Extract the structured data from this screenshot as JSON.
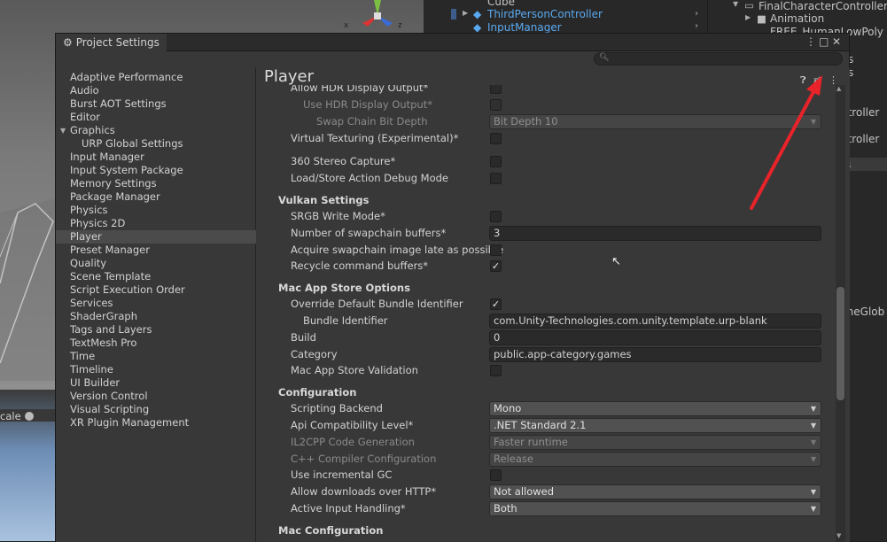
{
  "background": {
    "hierarchy": {
      "items": [
        "Cube",
        "ThirdPersonController",
        "InputManager"
      ]
    },
    "project": {
      "items": [
        "FinalCharacterController",
        "Animation",
        "FREE_HumanLowPoly"
      ],
      "clipped": [
        "s",
        "s",
        "ntroller",
        "ntroller",
        "s",
        "lineGlob",
        "r"
      ]
    },
    "scene": {
      "scale_label": "cale",
      "gizmo_x": "x",
      "gizmo_z": "z"
    }
  },
  "window": {
    "title": "Project Settings",
    "icons": {
      "menu": "⋮",
      "maximize": "□",
      "close": "✕"
    },
    "search_placeholder": ""
  },
  "sidebar": {
    "items": [
      {
        "label": "Adaptive Performance"
      },
      {
        "label": "Audio"
      },
      {
        "label": "Burst AOT Settings"
      },
      {
        "label": "Editor"
      },
      {
        "label": "Graphics",
        "expanded": true
      },
      {
        "label": "URP Global Settings",
        "child": true
      },
      {
        "label": "Input Manager"
      },
      {
        "label": "Input System Package"
      },
      {
        "label": "Memory Settings"
      },
      {
        "label": "Package Manager"
      },
      {
        "label": "Physics"
      },
      {
        "label": "Physics 2D"
      },
      {
        "label": "Player",
        "selected": true
      },
      {
        "label": "Preset Manager"
      },
      {
        "label": "Quality"
      },
      {
        "label": "Scene Template"
      },
      {
        "label": "Script Execution Order"
      },
      {
        "label": "Services"
      },
      {
        "label": "ShaderGraph"
      },
      {
        "label": "Tags and Layers"
      },
      {
        "label": "TextMesh Pro"
      },
      {
        "label": "Time"
      },
      {
        "label": "Timeline"
      },
      {
        "label": "UI Builder"
      },
      {
        "label": "Version Control"
      },
      {
        "label": "Visual Scripting"
      },
      {
        "label": "XR Plugin Management"
      }
    ]
  },
  "content": {
    "title": "Player",
    "rows": [
      {
        "label": "Allow HDR Display Output*",
        "indent": 1,
        "control": "checkbox",
        "checked": false
      },
      {
        "label": "Use HDR Display Output*",
        "indent": 2,
        "dim": true,
        "control": "checkbox",
        "checked": false
      },
      {
        "label": "Swap Chain Bit Depth",
        "indent": 3,
        "dim": true,
        "control": "dropdown",
        "value": "Bit Depth 10"
      },
      {
        "label": "Virtual Texturing (Experimental)*",
        "indent": 1,
        "control": "checkbox",
        "checked": false
      },
      {
        "label": "360 Stereo Capture*",
        "indent": 1,
        "control": "checkbox",
        "checked": false
      },
      {
        "label": "Load/Store Action Debug Mode",
        "indent": 1,
        "control": "checkbox",
        "checked": false
      },
      {
        "label": "Vulkan Settings",
        "header": true
      },
      {
        "label": "SRGB Write Mode*",
        "indent": 1,
        "control": "checkbox",
        "checked": false
      },
      {
        "label": "Number of swapchain buffers*",
        "indent": 1,
        "control": "field",
        "value": "3"
      },
      {
        "label": "Acquire swapchain image late as possible",
        "indent": 1,
        "control": "checkbox",
        "checked": false
      },
      {
        "label": "Recycle command buffers*",
        "indent": 1,
        "control": "checkbox",
        "checked": true
      },
      {
        "label": "Mac App Store Options",
        "header": true
      },
      {
        "label": "Override Default Bundle Identifier",
        "indent": 1,
        "control": "checkbox",
        "checked": true
      },
      {
        "label": "Bundle Identifier",
        "indent": 2,
        "control": "field",
        "value": "com.Unity-Technologies.com.unity.template.urp-blank"
      },
      {
        "label": "Build",
        "indent": 1,
        "control": "field",
        "value": "0"
      },
      {
        "label": "Category",
        "indent": 1,
        "control": "field",
        "value": "public.app-category.games"
      },
      {
        "label": "Mac App Store Validation",
        "indent": 1,
        "control": "checkbox",
        "checked": false
      },
      {
        "label": "Configuration",
        "header": true
      },
      {
        "label": "Scripting Backend",
        "indent": 1,
        "control": "dropdown",
        "value": "Mono"
      },
      {
        "label": "Api Compatibility Level*",
        "indent": 1,
        "control": "dropdown",
        "value": ".NET Standard 2.1"
      },
      {
        "label": "IL2CPP Code Generation",
        "indent": 1,
        "dim": true,
        "control": "dropdown",
        "value": "Faster runtime"
      },
      {
        "label": "C++ Compiler Configuration",
        "indent": 1,
        "dim": true,
        "control": "dropdown",
        "value": "Release"
      },
      {
        "label": "Use incremental GC",
        "indent": 1,
        "control": "checkbox",
        "checked": false
      },
      {
        "label": "Allow downloads over HTTP*",
        "indent": 1,
        "control": "dropdown",
        "value": "Not allowed"
      },
      {
        "label": "Active Input Handling*",
        "indent": 1,
        "control": "dropdown",
        "value": "Both"
      },
      {
        "label": "Mac Configuration",
        "header": true
      }
    ],
    "header_icons": {
      "help": "?",
      "presets": "⇄",
      "more": "⋮"
    }
  },
  "colors": {
    "accent_arrow": "#e8232a",
    "selection": "#4b4b4b",
    "panel": "#383838"
  }
}
